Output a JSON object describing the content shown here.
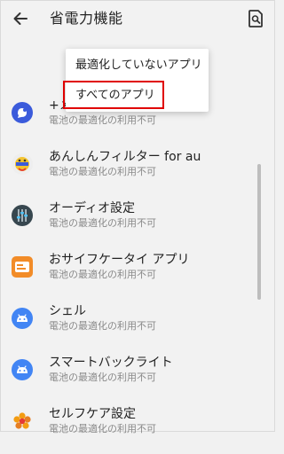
{
  "appbar": {
    "title": "省電力機能",
    "back_icon": "arrow-left-icon",
    "search_icon": "search-document-icon"
  },
  "menu": {
    "items": [
      {
        "label": "最適化していないアプリ"
      },
      {
        "label": "すべてのアプリ",
        "highlighted": true
      }
    ]
  },
  "apps": [
    {
      "name": "+メッセージ",
      "status": "電池の最適化の利用不可",
      "icon": "message-app-icon",
      "color": "#3b5bdb"
    },
    {
      "name": "あんしんフィルター for au",
      "status": "電池の最適化の利用不可",
      "icon": "filter-app-icon",
      "color": "#f4c430"
    },
    {
      "name": "オーディオ設定",
      "status": "電池の最適化の利用不可",
      "icon": "audio-settings-icon",
      "color": "#37474f"
    },
    {
      "name": "おサイフケータイ アプリ",
      "status": "電池の最適化の利用不可",
      "icon": "wallet-app-icon",
      "color": "#f28c28"
    },
    {
      "name": "シェル",
      "status": "電池の最適化の利用不可",
      "icon": "android-icon",
      "color": "#4285f4"
    },
    {
      "name": "スマートバックライト",
      "status": "電池の最適化の利用不可",
      "icon": "android-icon",
      "color": "#4285f4"
    },
    {
      "name": "セルフケア設定",
      "status": "電池の最適化の利用不可",
      "icon": "selfcare-flower-icon",
      "color": "#f39c12"
    }
  ],
  "colors": {
    "highlight": "#e00000",
    "background": "#f2f2f2"
  }
}
